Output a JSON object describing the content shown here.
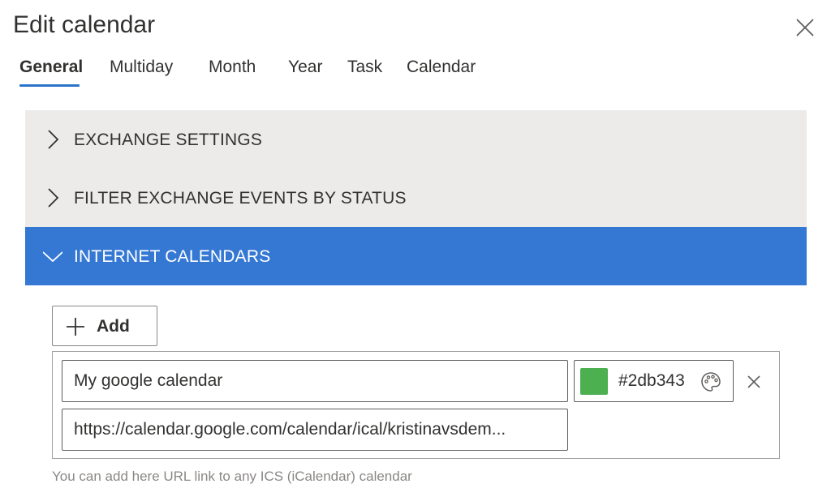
{
  "dialog": {
    "title": "Edit calendar"
  },
  "tabs": [
    {
      "label": "General",
      "active": true
    },
    {
      "label": "Multiday",
      "active": false
    },
    {
      "label": "Month",
      "active": false
    },
    {
      "label": "Year",
      "active": false
    },
    {
      "label": "Task",
      "active": false
    },
    {
      "label": "Calendar",
      "active": false
    }
  ],
  "sections": [
    {
      "label": "EXCHANGE SETTINGS",
      "expanded": false
    },
    {
      "label": "FILTER EXCHANGE EVENTS BY STATUS",
      "expanded": false
    },
    {
      "label": "INTERNET CALENDARS",
      "expanded": true
    }
  ],
  "internet_calendars": {
    "add_label": "Add",
    "items": [
      {
        "name": "My google calendar",
        "url": "https://calendar.google.com/calendar/ical/kristinavsdem...",
        "color": "#2db343",
        "swatch_color": "#4caf50"
      }
    ],
    "hint": "You can add here URL link to any ICS (iCalendar) calendar"
  },
  "colors": {
    "accent": "#3478d4",
    "tab_underline": "#2b73c9",
    "section_bg": "#edebe9"
  },
  "icons": {
    "close": "close-icon",
    "chevron_right": "chevron-right-icon",
    "chevron_down": "chevron-down-icon",
    "plus": "plus-icon",
    "palette": "palette-icon",
    "remove": "remove-icon"
  }
}
